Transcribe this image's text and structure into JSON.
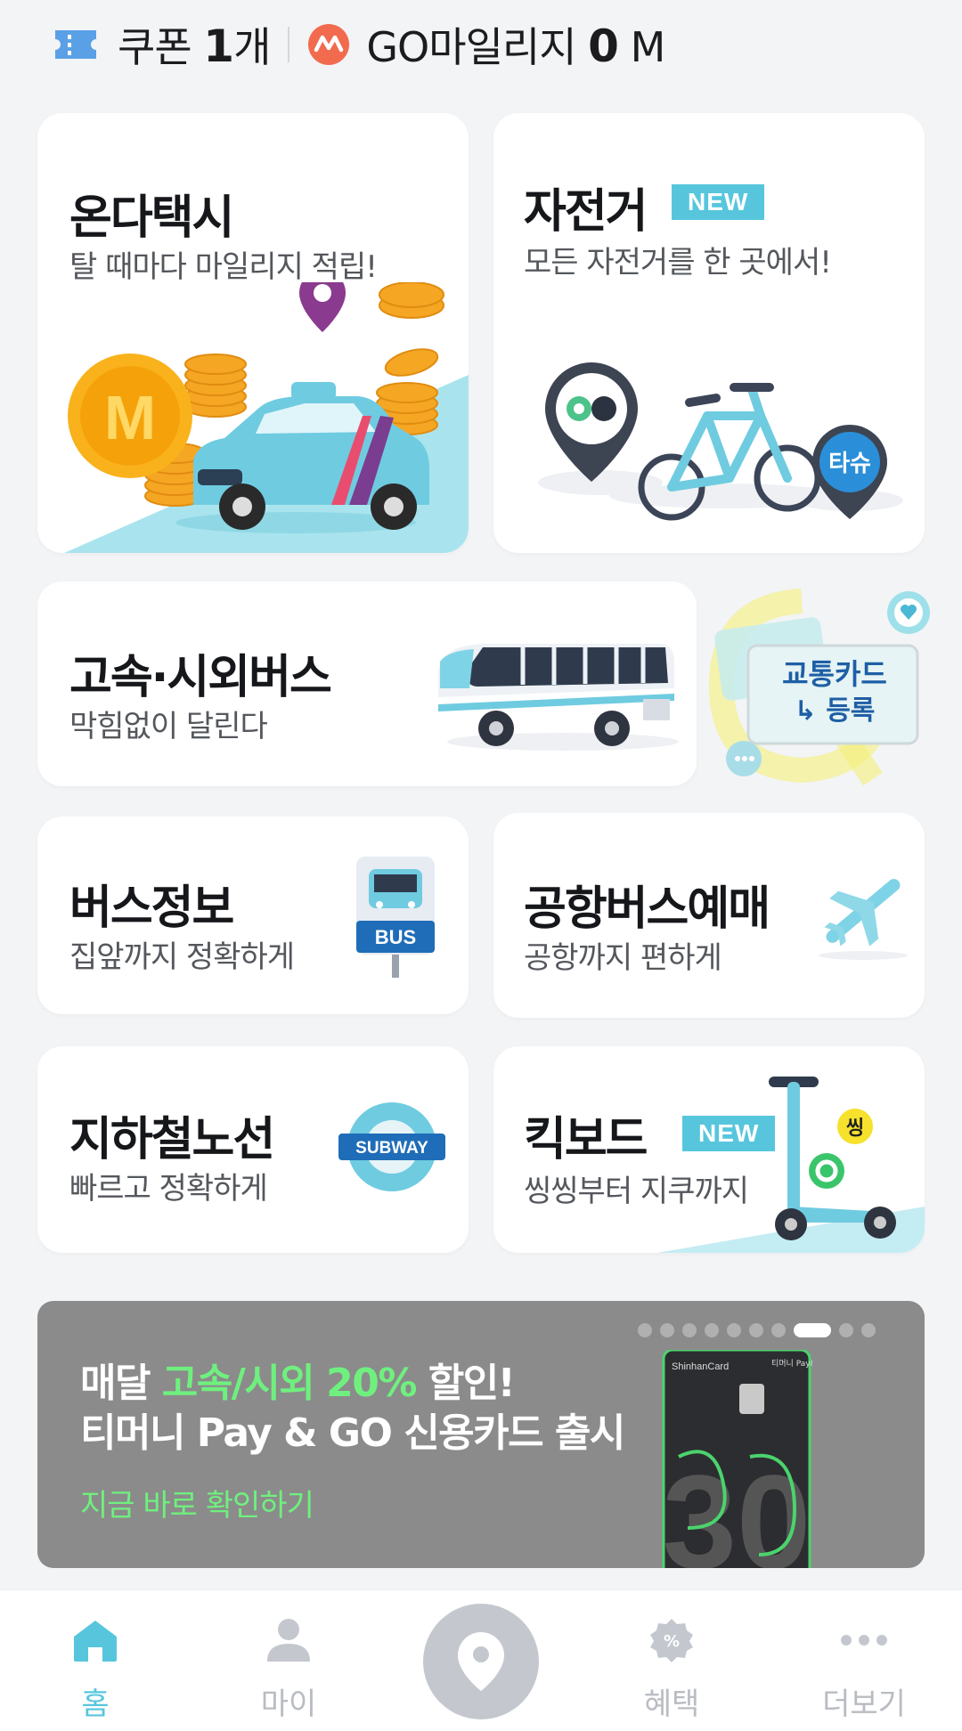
{
  "topbar": {
    "coupon_label": "쿠폰",
    "coupon_count": "1",
    "coupon_unit": "개",
    "mileage_label": "GO마일리지",
    "mileage_value": "0",
    "mileage_unit": "M"
  },
  "cards": {
    "taxi": {
      "title": "온다택시",
      "subtitle": "탈 때마다 마일리지 적립!",
      "coin_letter": "M"
    },
    "bike": {
      "title": "자전거",
      "badge": "NEW",
      "subtitle": "모든 자전거를 한 곳에서!",
      "pin_text": "타슈"
    },
    "express_bus": {
      "title": "고속·시외버스",
      "subtitle": "막힘없이 달린다"
    },
    "transit_card": {
      "label_line1": "교통카드",
      "label_line2": "↳ 등록"
    },
    "bus_info": {
      "title": "버스정보",
      "subtitle": "집앞까지 정확하게",
      "sign_text": "BUS"
    },
    "airport_bus": {
      "title": "공항버스예매",
      "subtitle": "공항까지 편하게"
    },
    "subway": {
      "title": "지하철노선",
      "subtitle": "빠르고 정확하게",
      "sign_text": "SUBWAY"
    },
    "kickboard": {
      "title": "킥보드",
      "badge": "NEW",
      "subtitle": "씽씽부터 지쿠까지",
      "logo_text": "씽"
    }
  },
  "banner": {
    "line1_prefix": "매달 ",
    "line1_highlight": "고속/시외 20%",
    "line1_suffix": " 할인!",
    "line2": "티머니 Pay & GO 신용카드 출시",
    "link": "지금 바로 확인하기",
    "card_brand": "ShinhanCard",
    "card_label": "티머니 Pay&GO",
    "card_number": "30",
    "dots_total": 10,
    "dots_active_index": 7
  },
  "nav": {
    "items": [
      {
        "label": "홈",
        "icon": "home-icon",
        "active": true
      },
      {
        "label": "마이",
        "icon": "person-icon",
        "active": false
      },
      {
        "label": "",
        "icon": "location-pin-icon",
        "active": false
      },
      {
        "label": "혜택",
        "icon": "benefit-badge-icon",
        "active": false
      },
      {
        "label": "더보기",
        "icon": "more-dots-icon",
        "active": false
      }
    ]
  },
  "colors": {
    "accent": "#57c6dd",
    "banner_bg": "#8b8b8b",
    "banner_highlight": "#6ff07e",
    "background": "#f3f4f6"
  }
}
